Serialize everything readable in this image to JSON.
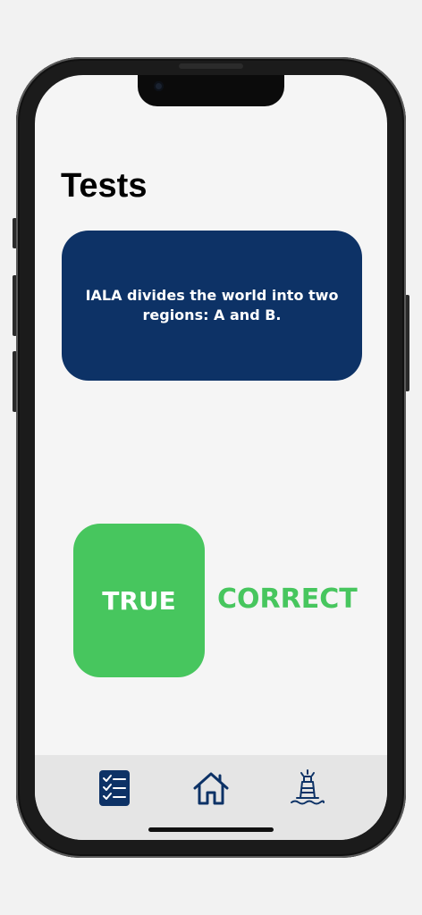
{
  "app": {
    "page_title": "Tests"
  },
  "question": {
    "text": "IALA divides the world into two regions: A and B."
  },
  "answer": {
    "button_label": "TRUE",
    "result_label": "CORRECT"
  },
  "tab_bar": {
    "items": [
      {
        "id": "tests",
        "icon": "checklist-icon",
        "active": true
      },
      {
        "id": "home",
        "icon": "home-icon",
        "active": false
      },
      {
        "id": "buoy",
        "icon": "buoy-icon",
        "active": false
      }
    ]
  },
  "colors": {
    "brand_navy": "#0d3266",
    "success_green": "#47c65e",
    "screen_background": "#f5f5f5",
    "tab_bar_background": "#e5e5e5"
  }
}
